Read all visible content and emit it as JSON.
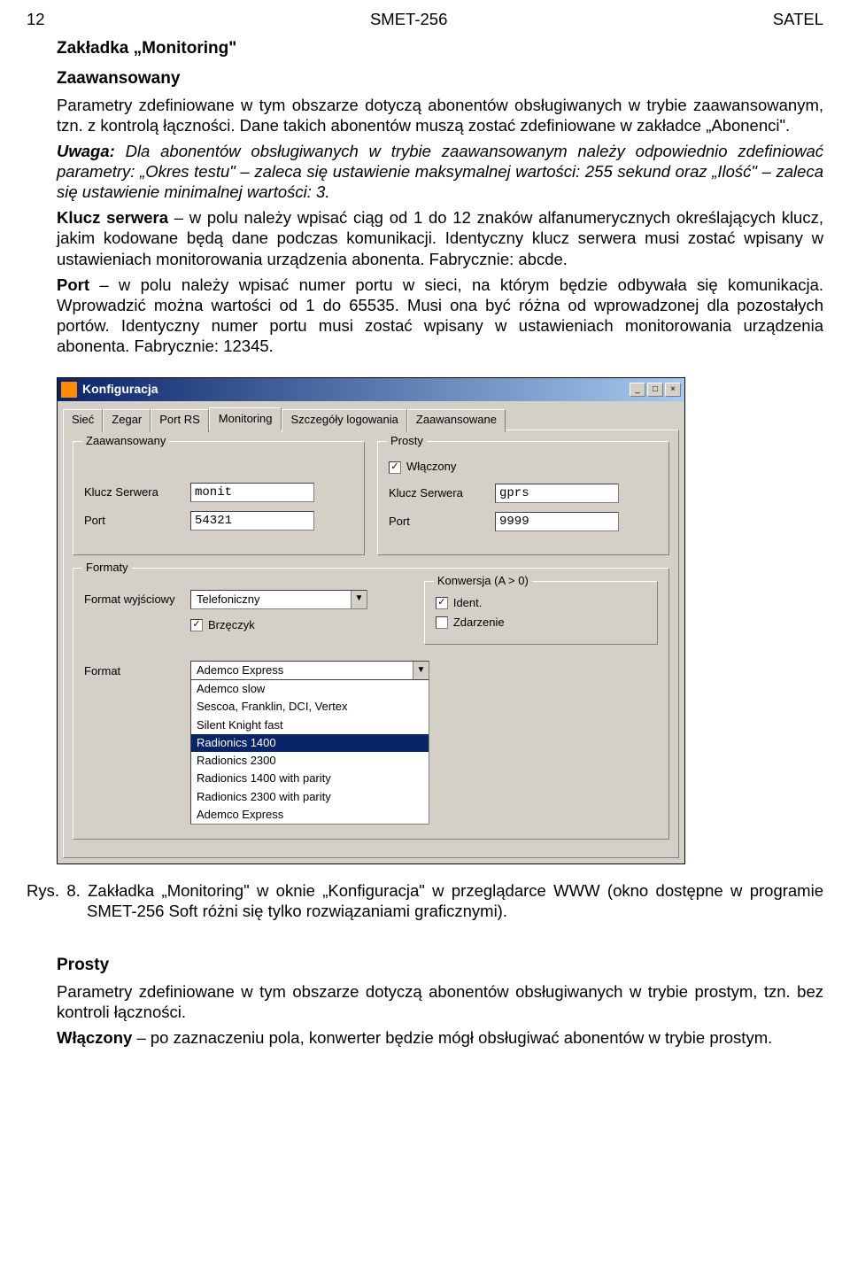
{
  "header": {
    "left": "12",
    "center": "SMET-256",
    "right": "SATEL"
  },
  "doc": {
    "h2": "Zakładka „Monitoring\"",
    "h3a": "Zaawansowany",
    "p1": "Parametry zdefiniowane w tym obszarze dotyczą abonentów obsługiwanych w trybie zaawansowanym, tzn. z kontrolą łączności. Dane takich abonentów muszą zostać zdefiniowane w zakładce „Abonenci\".",
    "noteLabel": "Uwaga:",
    "note": " Dla abonentów obsługiwanych w trybie zaawansowanym należy odpowiednio zdefiniować parametry: „Okres testu\" – zaleca się ustawienie maksymalnej wartości: 255 sekund oraz „Ilość\" – zaleca się ustawienie minimalnej wartości: 3.",
    "p2a": "Klucz serwera",
    "p2b": " – w polu należy wpisać ciąg od 1 do 12 znaków alfanumerycznych określających klucz, jakim kodowane będą dane podczas komunikacji. Identyczny klucz serwera musi zostać wpisany w ustawieniach monitorowania urządzenia abonenta. Fabrycznie: abcde.",
    "p3a": "Port",
    "p3b": " – w polu należy wpisać numer portu w sieci, na którym będzie odbywała się komunikacja. Wprowadzić można wartości od 1 do 65535. Musi ona być różna od wprowadzonej dla pozostałych portów. Identyczny numer portu musi zostać wpisany w ustawieniach monitorowania urządzenia abonenta. Fabrycznie: 12345.",
    "caption": "Rys. 8. Zakładka „Monitoring\" w oknie „Konfiguracja\" w przeglądarce WWW (okno dostępne w programie SMET-256 Soft różni się tylko rozwiązaniami graficznymi).",
    "h3b": "Prosty",
    "p4": "Parametry zdefiniowane w tym obszarze dotyczą abonentów obsługiwanych w trybie prostym, tzn. bez kontroli łączności.",
    "p5a": "Włączony",
    "p5b": " – po zaznaczeniu pola, konwerter będzie mógł obsługiwać abonentów w trybie prostym."
  },
  "win": {
    "title": "Konfiguracja",
    "tabs": [
      "Sieć",
      "Zegar",
      "Port RS",
      "Monitoring",
      "Szczegóły logowania",
      "Zaawansowane"
    ],
    "grp": {
      "adv": "Zaawansowany",
      "simple": "Prosty",
      "formaty": "Formaty",
      "konw": "Konwersja (A > 0)"
    },
    "labels": {
      "klucz": "Klucz Serwera",
      "port": "Port",
      "wlaczony": "Włączony",
      "formatw": "Format wyjściowy",
      "brzeczyk": "Brzęczyk",
      "ident": "Ident.",
      "zdarzenie": "Zdarzenie",
      "format": "Format"
    },
    "values": {
      "adv_klucz": "monit",
      "adv_port": "54321",
      "simple_klucz": "gprs",
      "simple_port": "9999",
      "formatw": "Telefoniczny",
      "format_sel": "Ademco Express"
    },
    "format_opts": [
      "Ademco slow",
      "Sescoa, Franklin, DCI, Vertex",
      "Silent Knight fast",
      "Radionics 1400",
      "Radionics 2300",
      "Radionics 1400 with parity",
      "Radionics 2300 with parity",
      "Ademco Express"
    ],
    "format_selected_index": 3
  }
}
